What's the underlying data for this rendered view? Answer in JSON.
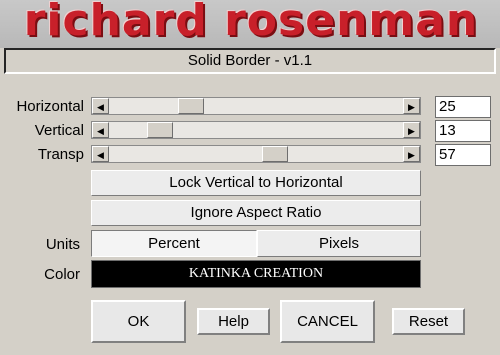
{
  "logo_text": "richard rosenman",
  "title": "Solid Border - v1.1",
  "sliders": [
    {
      "label": "Horizontal",
      "value": "25",
      "level": 0.25
    },
    {
      "label": "Vertical",
      "value": "13",
      "level": 0.13
    },
    {
      "label": "Transp",
      "value": "57",
      "level": 0.57
    }
  ],
  "buttons": {
    "lock": "Lock Vertical to Horizontal",
    "ignore": "Ignore Aspect Ratio",
    "ok": "OK",
    "help": "Help",
    "cancel": "CANCEL",
    "reset": "Reset"
  },
  "units": {
    "label": "Units",
    "options": [
      "Percent",
      "Pixels"
    ],
    "selected": "Percent"
  },
  "color": {
    "label": "Color",
    "swatch_text": "KATINKA CREATION",
    "value": "#000000"
  },
  "icons": {
    "left_arrow": "left-arrow-icon",
    "right_arrow": "right-arrow-icon"
  }
}
